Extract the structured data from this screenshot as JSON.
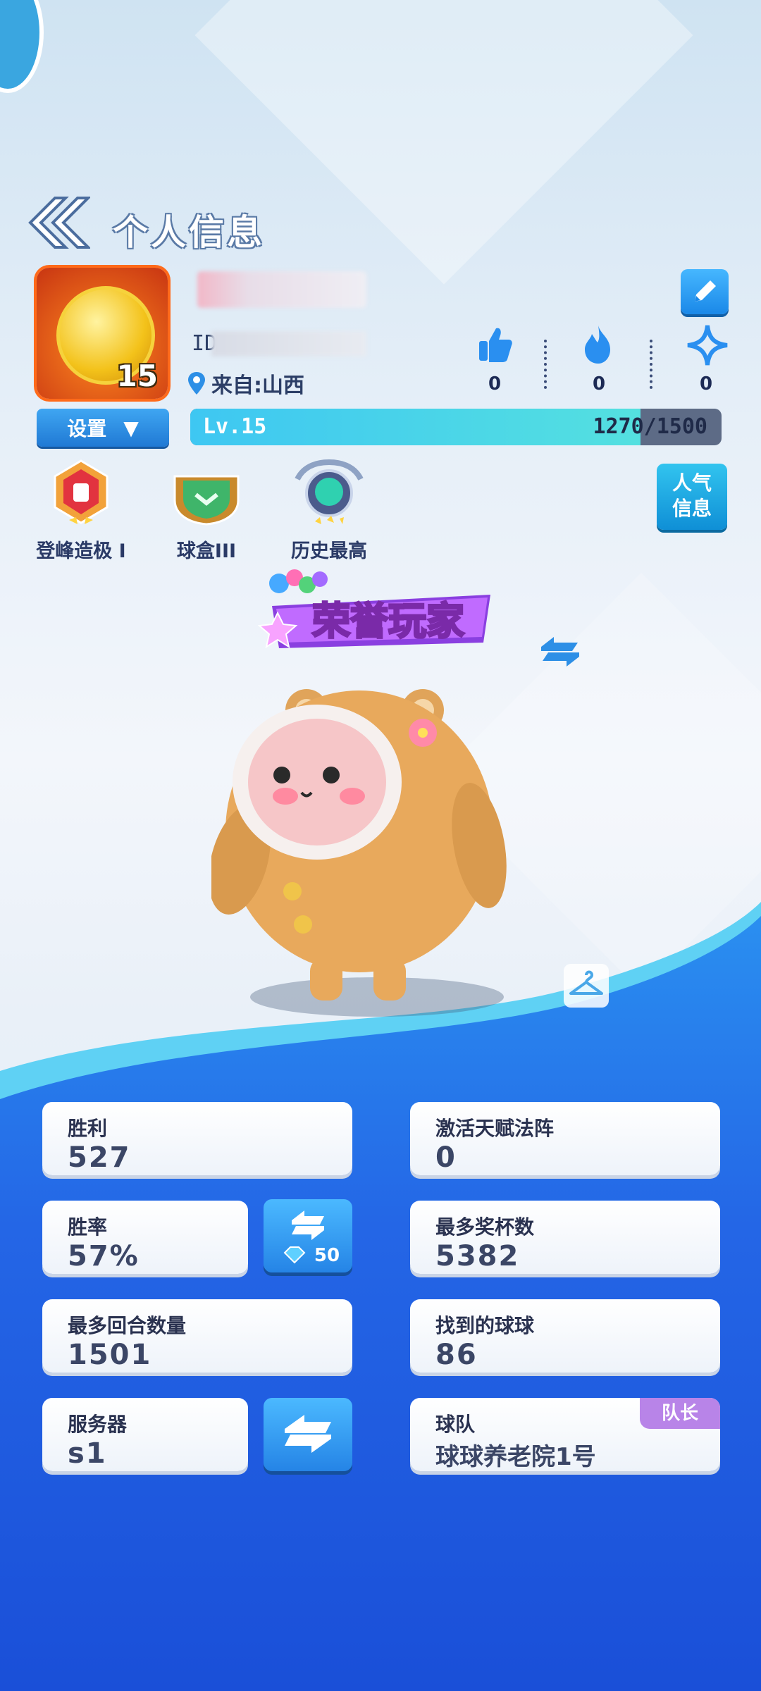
{
  "header": {
    "title": "个人信息"
  },
  "profile": {
    "avatar_level": "15",
    "id_prefix": "ID",
    "location": "来自:山西",
    "settings_label": "设置",
    "level_label": "Lv.15",
    "xp_text": "1270/1500",
    "xp_progress": 0.847
  },
  "social": [
    {
      "icon": "thumbs-up-icon",
      "count": "0"
    },
    {
      "icon": "fire-icon",
      "count": "0"
    },
    {
      "icon": "star-icon",
      "count": "0"
    }
  ],
  "badges": [
    {
      "icon": "peak-badge-icon",
      "label": "登峰造极 I"
    },
    {
      "icon": "ball-box-badge-icon",
      "label": "球盒III"
    },
    {
      "icon": "history-best-badge-icon",
      "label": "历史最高"
    }
  ],
  "popularity_button": {
    "line1": "人气",
    "line2": "信息"
  },
  "title_banner": "荣誉玩家",
  "stats": {
    "wins": {
      "label": "胜利",
      "value": "527"
    },
    "talent": {
      "label": "激活天赋法阵",
      "value": "0"
    },
    "win_rate": {
      "label": "胜率",
      "value": "57%"
    },
    "reset_cost": "50",
    "trophies": {
      "label": "最多奖杯数",
      "value": "5382"
    },
    "rounds": {
      "label": "最多回合数量",
      "value": "1501"
    },
    "balls": {
      "label": "找到的球球",
      "value": "86"
    },
    "server": {
      "label": "服务器",
      "value": "s1"
    },
    "team": {
      "label": "球队",
      "value": "球球养老院1号",
      "role": "队长"
    }
  },
  "colors": {
    "accent": "#2584e6",
    "bottom_blue": "#1f5fe0",
    "leader_tag": "#b884e8"
  }
}
